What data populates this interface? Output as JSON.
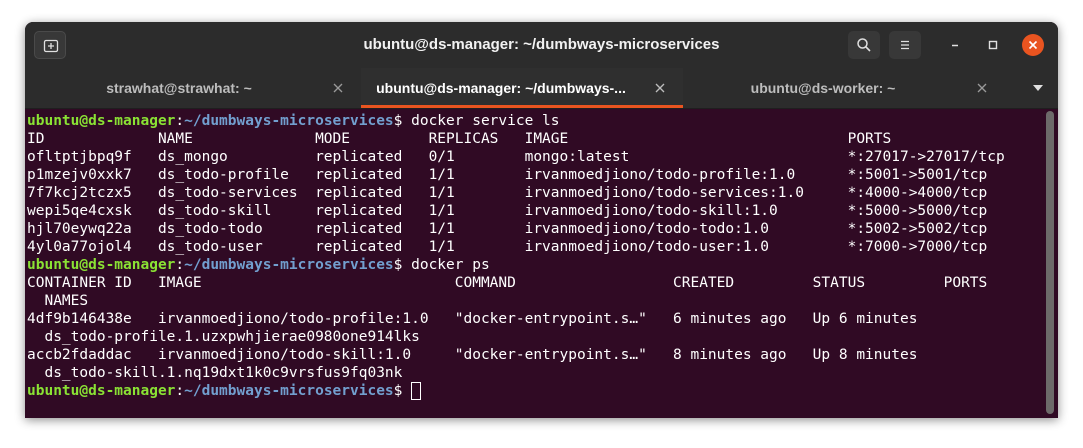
{
  "window": {
    "title": "ubuntu@ds-manager: ~/dumbways-microservices"
  },
  "titlebar": {
    "icons": [
      "new-tab-icon",
      "search-icon",
      "hamburger-menu-icon",
      "minimize-icon",
      "maximize-icon",
      "close-icon"
    ]
  },
  "tabs": [
    {
      "label": "strawhat@strawhat: ~",
      "active": false
    },
    {
      "label": "ubuntu@ds-manager: ~/dumbways-...",
      "active": true
    },
    {
      "label": "ubuntu@ds-worker: ~",
      "active": false
    }
  ],
  "colors": {
    "terminal_bg": "#300a24",
    "prompt_user": "#8ae234",
    "prompt_path": "#729fcf",
    "accent": "#e95420",
    "titlebar_bg": "#2c2c2c"
  },
  "terminal": {
    "lines": [
      {
        "user": "ubuntu@ds-manager",
        "sep": ":",
        "path": "~/dumbways-microservices",
        "suffix": "$ docker service ls"
      },
      {
        "text": "ID             NAME              MODE         REPLICAS   IMAGE                                PORTS"
      },
      {
        "text": "ofltptjbpq9f   ds_mongo          replicated   0/1        mongo:latest                         *:27017->27017/tcp"
      },
      {
        "text": "p1mzejv0xxk7   ds_todo-profile   replicated   1/1        irvanmoedjiono/todo-profile:1.0      *:5001->5001/tcp"
      },
      {
        "text": "7f7kcj2tczx5   ds_todo-services  replicated   1/1        irvanmoedjiono/todo-services:1.0     *:4000->4000/tcp"
      },
      {
        "text": "wepi5qe4cxsk   ds_todo-skill     replicated   1/1        irvanmoedjiono/todo-skill:1.0        *:5000->5000/tcp"
      },
      {
        "text": "hjl70eywq22a   ds_todo-todo      replicated   1/1        irvanmoedjiono/todo-todo:1.0         *:5002->5002/tcp"
      },
      {
        "text": "4yl0a77ojol4   ds_todo-user      replicated   1/1        irvanmoedjiono/todo-user:1.0         *:7000->7000/tcp"
      },
      {
        "user": "ubuntu@ds-manager",
        "sep": ":",
        "path": "~/dumbways-microservices",
        "suffix": "$ docker ps"
      },
      {
        "text": "CONTAINER ID   IMAGE                             COMMAND                  CREATED         STATUS         PORTS"
      },
      {
        "text": "  NAMES"
      },
      {
        "text": "4df9b146438e   irvanmoedjiono/todo-profile:1.0   \"docker-entrypoint.s…\"   6 minutes ago   Up 6 minutes"
      },
      {
        "text": "  ds_todo-profile.1.uzxpwhjierae0980one914lks"
      },
      {
        "text": "accb2fdaddac   irvanmoedjiono/todo-skill:1.0     \"docker-entrypoint.s…\"   8 minutes ago   Up 8 minutes"
      },
      {
        "text": "  ds_todo-skill.1.nq19dxt1k0c9vrsfus9fq03nk"
      },
      {
        "user": "ubuntu@ds-manager",
        "sep": ":",
        "path": "~/dumbways-microservices",
        "suffix": "$ ",
        "cursor": true
      }
    ]
  }
}
